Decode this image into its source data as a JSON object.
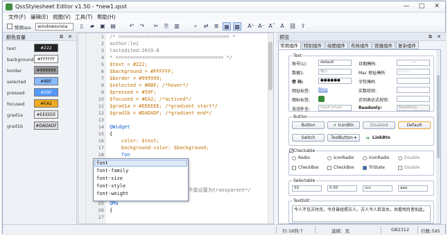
{
  "title": "QssStylesheet Editor v1.50 - *new1.qsst",
  "window_buttons": [
    "—",
    "□",
    "✕"
  ],
  "menu": [
    "文件(F)",
    "编辑(E)",
    "视图(V)",
    "工具(T)",
    "帮助(H)"
  ],
  "toolbar": {
    "disable_label": "禁用qss",
    "style_value": "windowsvista"
  },
  "left_panel": {
    "title": "颜色变量",
    "variables": [
      {
        "name": "text",
        "value": "#222",
        "bg": "#222222",
        "fg": "#ffffff"
      },
      {
        "name": "background",
        "value": "#FFFFFF",
        "bg": "#ffffff",
        "fg": "#222222"
      },
      {
        "name": "border",
        "value": "#999999",
        "bg": "#999999",
        "fg": "#111111"
      },
      {
        "name": "selected",
        "value": "#8BF",
        "bg": "#88bbff",
        "fg": "#111111"
      },
      {
        "name": "pressed",
        "value": "#59F",
        "bg": "#5599ff",
        "fg": "#ffffff"
      },
      {
        "name": "focused",
        "value": "#EA2",
        "bg": "#eeaa22",
        "fg": "#111111"
      },
      {
        "name": "grad1a",
        "value": "#EEEEEE",
        "bg": "#eeeeee",
        "fg": "#111111"
      },
      {
        "name": "grad1b",
        "value": "#DADADF",
        "bg": "#dadadf",
        "fg": "#111111"
      }
    ]
  },
  "editor": {
    "line_numbers": [
      "1",
      "2",
      "3",
      "4",
      "5",
      "6",
      "7",
      "8",
      "9",
      "10",
      "11",
      "12",
      "13",
      "14",
      "15",
      "16",
      "17",
      "18",
      "19",
      "20",
      "21",
      "22",
      "23",
      "24",
      "25",
      "26",
      "27"
    ],
    "lines": [
      {
        "n": 1,
        "t": "/* ====================================== *",
        "c": "com"
      },
      {
        "n": 2,
        "t": "author:lei",
        "c": "com"
      },
      {
        "n": 3,
        "t": "lastedited:2019.8",
        "c": "com"
      },
      {
        "n": 4,
        "t": "* ===================================== */",
        "c": "com"
      },
      {
        "n": 5,
        "t": "$text = #222;",
        "c": "var"
      },
      {
        "n": 6,
        "t": "$background = #FFFFFF;",
        "c": "var"
      },
      {
        "n": 7,
        "t": "$border = #999999;",
        "c": "var"
      },
      {
        "n": 8,
        "t": "$selected = #8BF; /*hover*/",
        "c": "var"
      },
      {
        "n": 9,
        "t": "$pressed = #59F;",
        "c": "var"
      },
      {
        "n": 10,
        "t": "$focused = #EA2; /*actived*/",
        "c": "var"
      },
      {
        "n": 11,
        "t": "$grad1a = #EEEEEE; /*gradient start*/",
        "c": "var"
      },
      {
        "n": 12,
        "t": "$grad1b = #DADADF; /*gradient end*/",
        "c": "var"
      },
      {
        "n": 14,
        "t": "QWidget",
        "c": "kw"
      },
      {
        "n": 15,
        "t": "{",
        "c": "txt"
      },
      {
        "n": 16,
        "t": "    color: $text;",
        "c": "var"
      },
      {
        "n": 17,
        "t": "    background-color: $background;",
        "c": "var"
      },
      {
        "n": 18,
        "t": "    fon",
        "c": "kw"
      },
      {
        "n": 19,
        "t": "}",
        "c": "txt"
      },
      {
        "n": 21,
        "t": "QFr",
        "c": "kw"
      },
      {
        "n": 22,
        "t": "{",
        "c": "txt"
      },
      {
        "n": 23,
        "t": "                           不能设置为transparent*/",
        "c": "com"
      },
      {
        "n": 25,
        "t": "QMa",
        "c": "kw"
      },
      {
        "n": 26,
        "t": "{",
        "c": "txt"
      }
    ]
  },
  "autocomplete": [
    "font",
    "font-family",
    "font-size",
    "font-style",
    "font-weight"
  ],
  "preview": {
    "title": "预览",
    "tabs": [
      "常用组件",
      "特别组件",
      "绘图组件",
      "布局组件",
      "容器组件",
      "复杂组件"
    ],
    "text_group": {
      "title": "Text",
      "account_label": "账号(L):",
      "account_value": "default",
      "date_label": "日期掩码:",
      "date_value": "-  -",
      "number_label": "数据1:",
      "number_placeholder": "输入",
      "mac_label": "Mac 地址掩码",
      "mac_value": ":  :  :  :  :",
      "password_label": "密  码:",
      "password_value": "●●●●●●",
      "charmask_label": "字符掩码",
      "url_label": "网址标签:",
      "url_link": "Blog",
      "realtime_label": "实数校验:",
      "icon_label": "图标标签:",
      "regex_label": "正则表达式校验:",
      "auto_label": "自动补全:",
      "auto_placeholder": "input email",
      "readonly_label": "Readonly:",
      "readonly_placeholder": "ReadOnly"
    },
    "button_group": {
      "title": "Button",
      "buttons": [
        "Button",
        "IconBtn",
        "Disabled",
        "Default",
        "Switch",
        "ToolButton ▾",
        "LinkBtn"
      ]
    },
    "checkable_group": {
      "title": "Checkable",
      "radios": [
        "Radio",
        "IconRadio",
        "IconRadio",
        "Disable"
      ],
      "checks": [
        "CheckBox",
        "CheckBox",
        "TriState",
        "Disable"
      ]
    },
    "selectable_group": {
      "title": "Selectable",
      "spin1": "50",
      "spin2": "0.50",
      "combo1": "ccc",
      "combo2": "aaa"
    },
    "textedit_group": {
      "title": "TextEdit",
      "text": "今人不见古时月，今月曾经照古人。古人今人若流水，共看明月皆如此。"
    }
  },
  "status": {
    "position": "行:18列:7",
    "selection": "选择：无",
    "encoding": "GB2312",
    "total": "行数:595"
  }
}
